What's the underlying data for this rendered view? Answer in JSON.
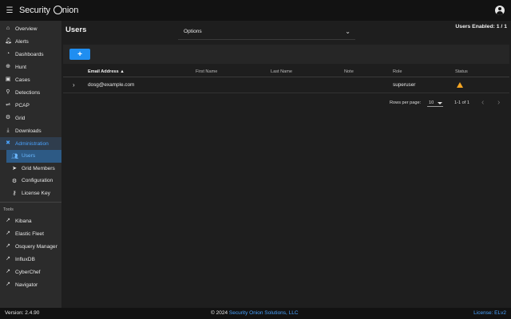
{
  "app": {
    "brand_prefix": "Security ",
    "brand_suffix": "nion",
    "menu_icon": "hamburger-icon"
  },
  "sidebar": {
    "items": [
      {
        "label": "Overview",
        "icon": "home-icon"
      },
      {
        "label": "Alerts",
        "icon": "bell-icon"
      },
      {
        "label": "Dashboards",
        "icon": "dashboard-icon"
      },
      {
        "label": "Hunt",
        "icon": "crosshair-icon"
      },
      {
        "label": "Cases",
        "icon": "briefcase-icon"
      },
      {
        "label": "Detections",
        "icon": "search-icon"
      },
      {
        "label": "PCAP",
        "icon": "pcap-icon"
      },
      {
        "label": "Grid",
        "icon": "grid-icon"
      },
      {
        "label": "Downloads",
        "icon": "download-icon"
      },
      {
        "label": "Administration",
        "icon": "admin-icon"
      }
    ],
    "admin_sub": [
      {
        "label": "Users",
        "icon": "users-icon"
      },
      {
        "label": "Grid Members",
        "icon": "send-icon"
      },
      {
        "label": "Configuration",
        "icon": "gear-icon"
      },
      {
        "label": "License Key",
        "icon": "key-icon"
      }
    ],
    "tools_label": "Tools",
    "tools": [
      {
        "label": "Kibana"
      },
      {
        "label": "Elastic Fleet"
      },
      {
        "label": "Osquery Manager"
      },
      {
        "label": "InfluxDB"
      },
      {
        "label": "CyberChef"
      },
      {
        "label": "Navigator"
      }
    ]
  },
  "main": {
    "title": "Users",
    "options_label": "Options",
    "users_enabled": "Users Enabled: 1 / 1",
    "add_label": "+",
    "columns": [
      "Email Address",
      "First Name",
      "Last Name",
      "Note",
      "Role",
      "Status"
    ],
    "sort_arrow": "▲",
    "rows": [
      {
        "email": "dosg@example.com",
        "first": "",
        "last": "",
        "note": "",
        "role": "superuser",
        "status": "warning-icon"
      }
    ],
    "pager": {
      "rows_per_page_label": "Rows per page:",
      "rows_per_page": "10",
      "range": "1-1 of 1",
      "prev": "‹",
      "next": "›"
    }
  },
  "footer": {
    "version": "Version: 2.4.90",
    "copyright_prefix": "© 2024 ",
    "copyright_link": "Security Onion Solutions, LLC",
    "license": "License: ELv2"
  },
  "colors": {
    "accent": "#1f8ef1",
    "active_nav": "#4aa3ff",
    "warning": "#f6a623"
  }
}
